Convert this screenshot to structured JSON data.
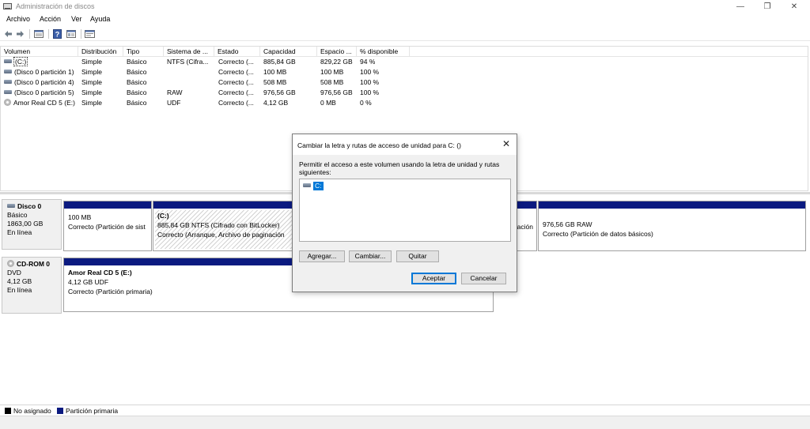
{
  "window": {
    "title": "Administración de discos",
    "controls": {
      "minimize": "—",
      "maximize": "❐",
      "close": "✕"
    }
  },
  "menu": [
    "Archivo",
    "Acción",
    "Ver",
    "Ayuda"
  ],
  "toolbar": {
    "icons": [
      "back-icon",
      "forward-icon",
      "view-list-icon",
      "help-icon",
      "view-details-icon",
      "properties-icon"
    ]
  },
  "volume_table": {
    "columns": [
      "Volumen",
      "Distribución",
      "Tipo",
      "Sistema de ...",
      "Estado",
      "Capacidad",
      "Espacio ...",
      "% disponible"
    ],
    "rows": [
      {
        "icon": "drive-icon",
        "volume": "(C:)",
        "layout": "Simple",
        "type": "Básico",
        "fs": "NTFS (Cifra...",
        "status": "Correcto (...",
        "capacity": "885,84 GB",
        "free": "829,22 GB",
        "pct": "94 %"
      },
      {
        "icon": "drive-icon",
        "volume": "(Disco 0 partición 1)",
        "layout": "Simple",
        "type": "Básico",
        "fs": "",
        "status": "Correcto (...",
        "capacity": "100 MB",
        "free": "100 MB",
        "pct": "100 %"
      },
      {
        "icon": "drive-icon",
        "volume": "(Disco 0 partición 4)",
        "layout": "Simple",
        "type": "Básico",
        "fs": "",
        "status": "Correcto (...",
        "capacity": "508 MB",
        "free": "508 MB",
        "pct": "100 %"
      },
      {
        "icon": "drive-icon",
        "volume": "(Disco 0 partición 5)",
        "layout": "Simple",
        "type": "Básico",
        "fs": "RAW",
        "status": "Correcto (...",
        "capacity": "976,56 GB",
        "free": "976,56 GB",
        "pct": "100 %"
      },
      {
        "icon": "cd-icon",
        "volume": "Amor Real CD 5 (E:)",
        "layout": "Simple",
        "type": "Básico",
        "fs": "UDF",
        "status": "Correcto (...",
        "capacity": "4,12 GB",
        "free": "0 MB",
        "pct": "0 %"
      }
    ]
  },
  "disks": [
    {
      "name": "Disco 0",
      "kind": "Básico",
      "size": "1863,00 GB",
      "state": "En línea",
      "partitions": [
        {
          "title": "",
          "line1": "100 MB",
          "line2": "Correcto (Partición de sist"
        },
        {
          "title": "(C:)",
          "line1": "885,84 GB NTFS (Cifrado con BitLocker)",
          "line2": "Correcto (Arranque, Archivo de paginación"
        },
        {
          "title": "",
          "line1": "",
          "line2": "ación"
        },
        {
          "title": "",
          "line1": "976,56 GB RAW",
          "line2": "Correcto (Partición de datos básicos)"
        }
      ]
    },
    {
      "name": "CD-ROM 0",
      "kind": "DVD",
      "size": "4,12 GB",
      "state": "En línea",
      "partitions": [
        {
          "title": "Amor Real CD 5  (E:)",
          "line1": "4,12 GB UDF",
          "line2": "Correcto (Partición primaria)"
        }
      ]
    }
  ],
  "legend": [
    {
      "label": "No asignado",
      "color": "#000000"
    },
    {
      "label": "Partición primaria",
      "color": "#0b1a80"
    }
  ],
  "dialog": {
    "title": "Cambiar la letra y rutas de acceso de unidad para C: ()",
    "description": "Permitir el acceso a este volumen usando la letra de unidad y rutas siguientes:",
    "list_items": [
      "C:"
    ],
    "buttons": {
      "add": "Agregar...",
      "change": "Cambiar...",
      "remove": "Quitar",
      "ok": "Aceptar",
      "cancel": "Cancelar"
    },
    "close": "✕"
  }
}
